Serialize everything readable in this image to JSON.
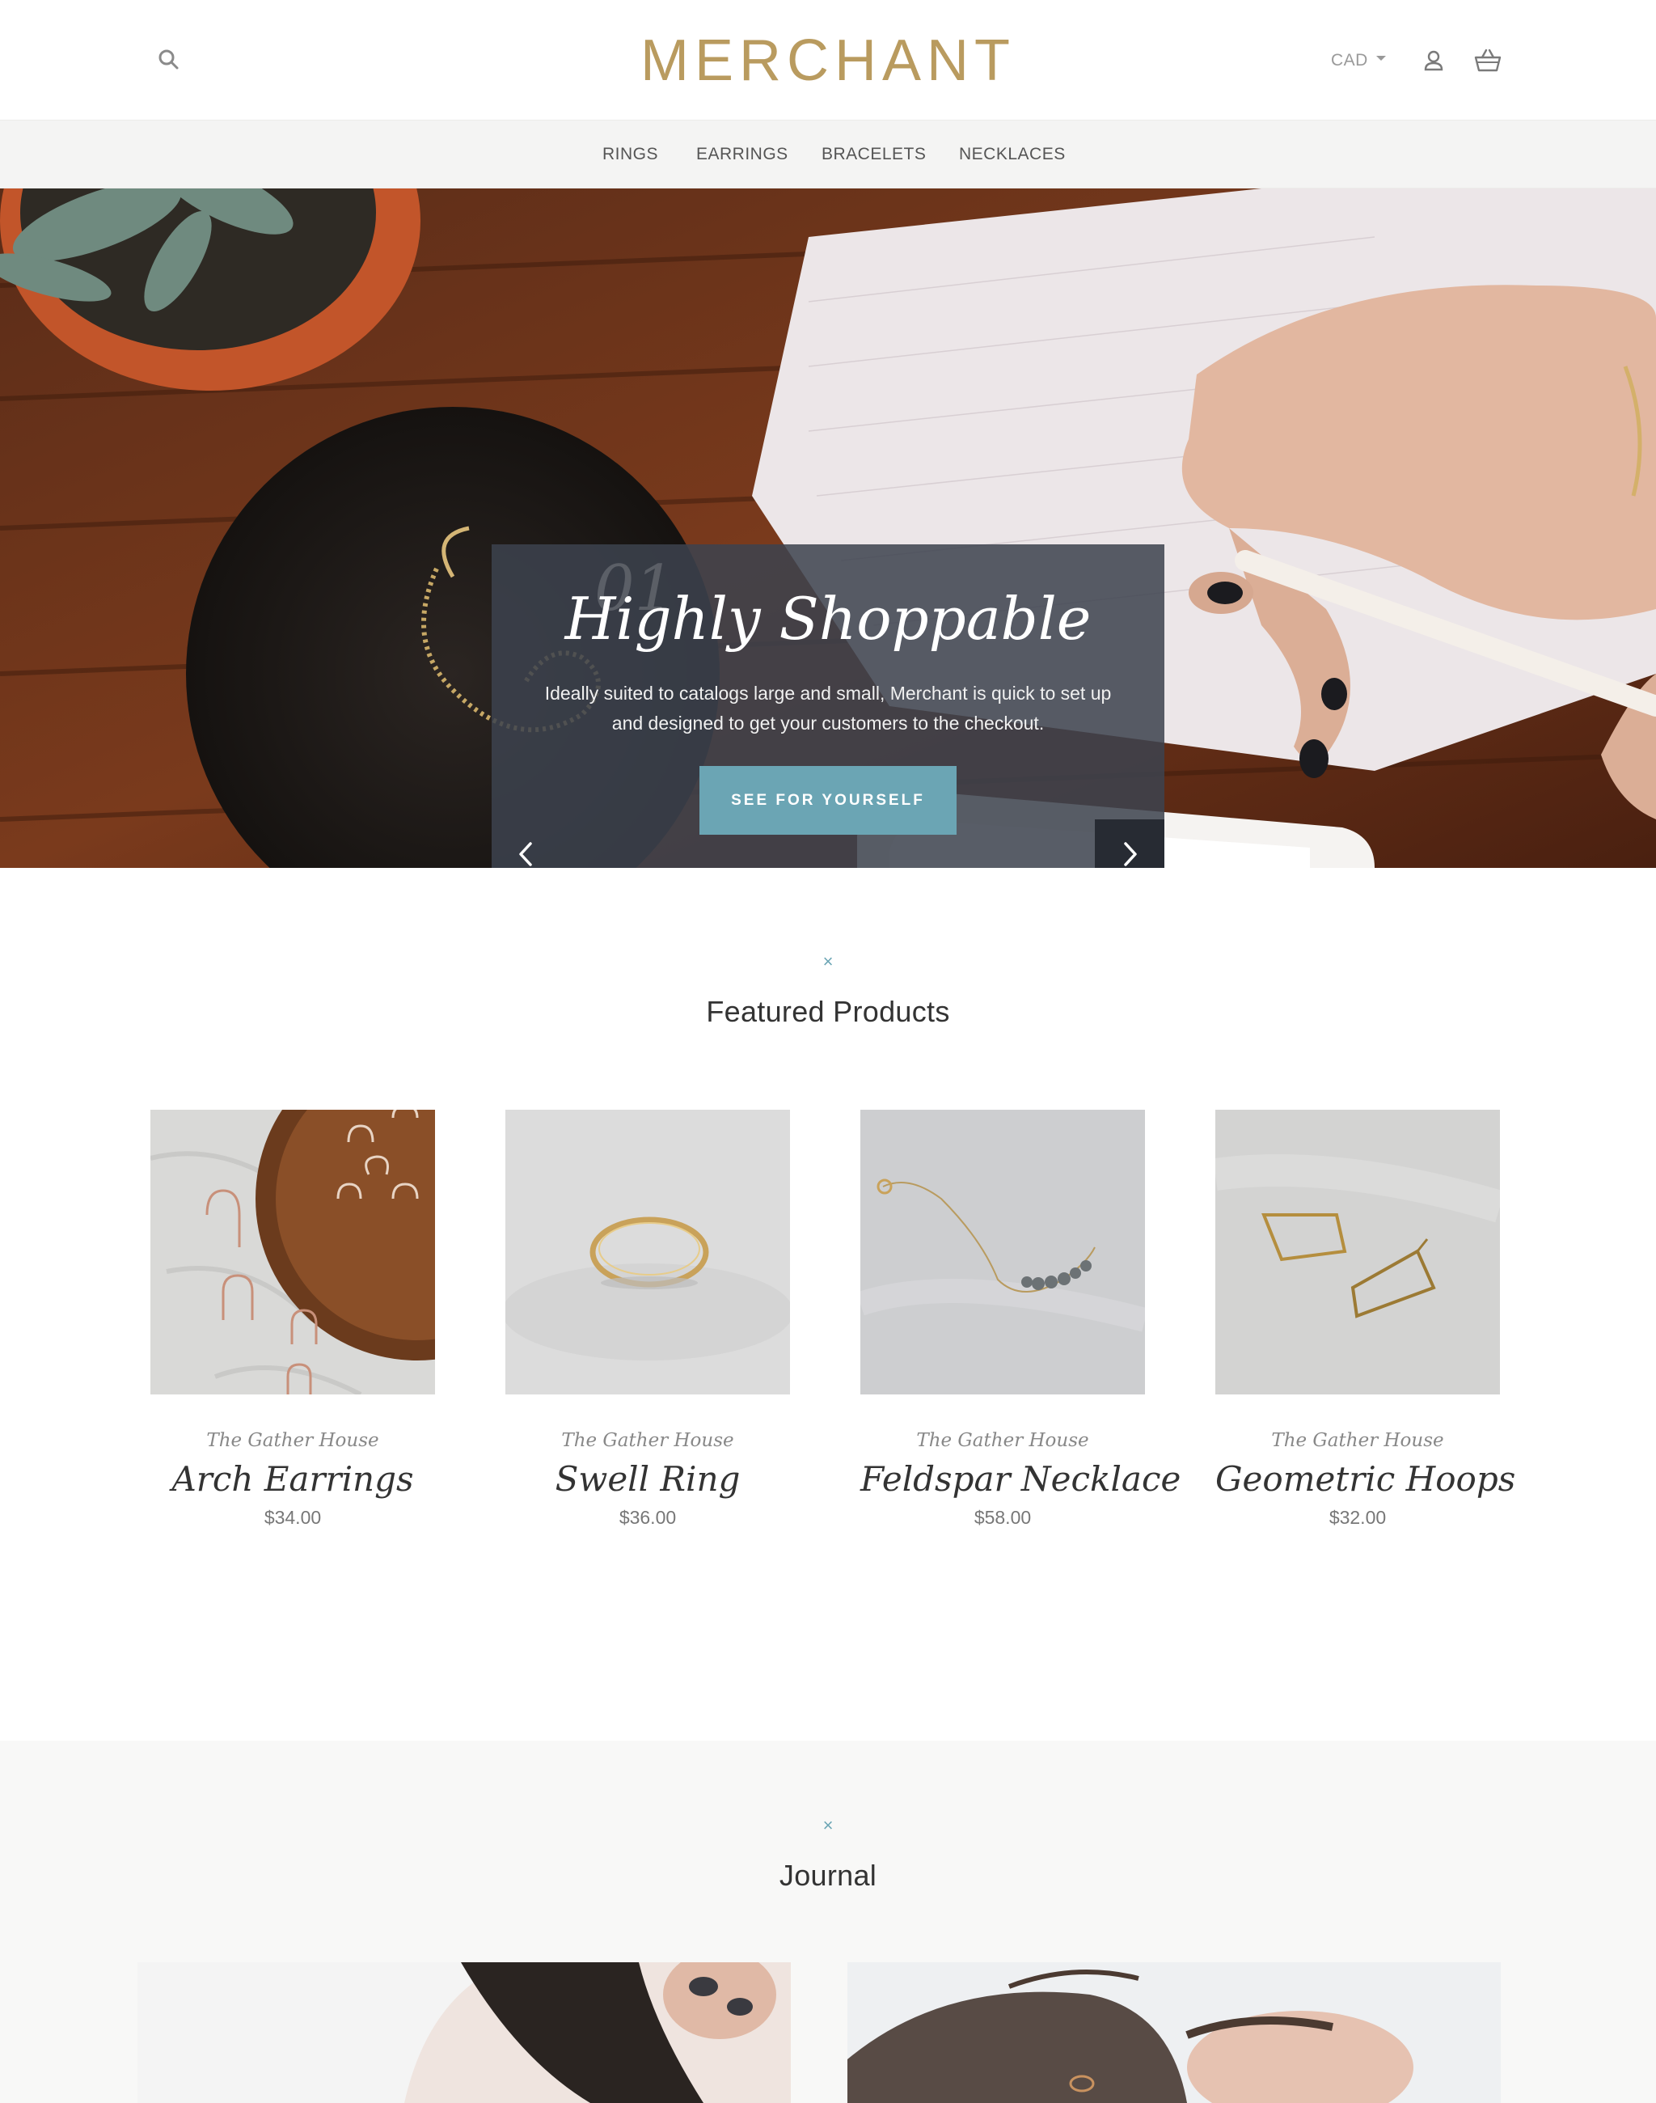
{
  "header": {
    "logo": "MERCHANT",
    "currency": "CAD",
    "icons": [
      "search-icon",
      "account-icon",
      "cart-icon"
    ]
  },
  "nav": {
    "items": [
      "RINGS",
      "EARRINGS",
      "BRACELETS",
      "NECKLACES"
    ]
  },
  "hero": {
    "slide_number": "01",
    "title": "Highly Shoppable",
    "text": "Ideally suited to catalogs large and small, Merchant is quick to set up and designed to get your customers to the checkout.",
    "cta": "SEE FOR YOURSELF"
  },
  "featured": {
    "mark": "×",
    "title": "Featured Products",
    "products": [
      {
        "vendor": "The Gather House",
        "name": "Arch Earrings",
        "price": "$34.00"
      },
      {
        "vendor": "The Gather House",
        "name": "Swell Ring",
        "price": "$36.00"
      },
      {
        "vendor": "The Gather House",
        "name": "Feldspar Necklace",
        "price": "$58.00"
      },
      {
        "vendor": "The Gather House",
        "name": "Geometric Hoops",
        "price": "$32.00"
      }
    ]
  },
  "journal": {
    "mark": "×",
    "title": "Journal"
  },
  "colors": {
    "accent": "#6ba5b4",
    "logo": "#b99b5f",
    "dark": "#272b33"
  }
}
